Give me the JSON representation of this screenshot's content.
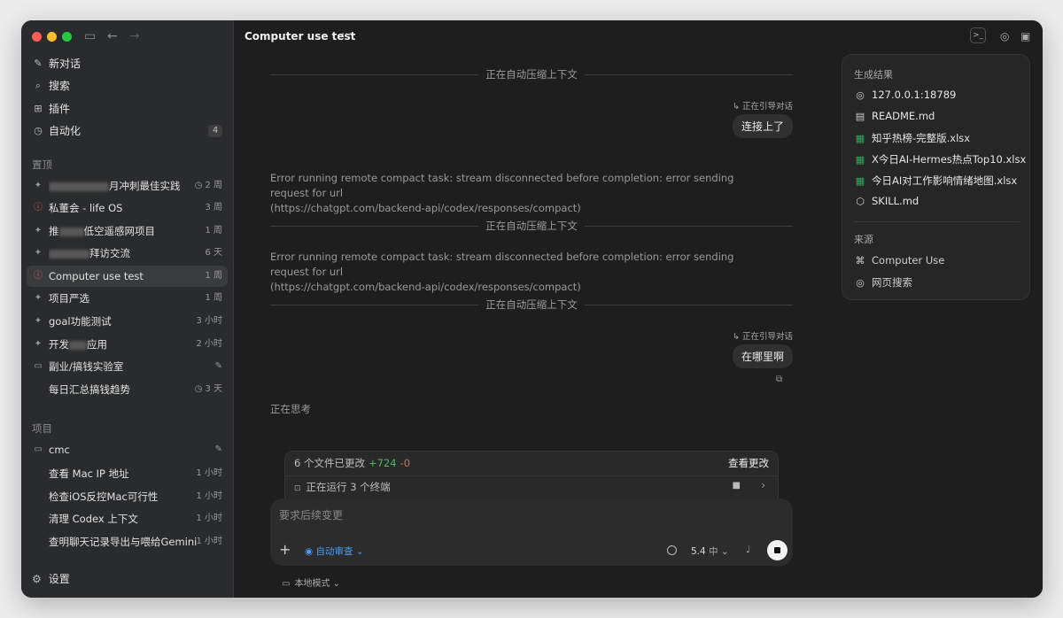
{
  "sidebar": {
    "nav": [
      {
        "icon": "edit-icon",
        "label": "新对话"
      },
      {
        "icon": "search-icon",
        "label": "搜索"
      },
      {
        "icon": "plugin-icon",
        "label": "插件"
      },
      {
        "icon": "clock-icon",
        "label": "自动化",
        "badge": "4"
      }
    ],
    "pinned_title": "置顶",
    "pinned": [
      {
        "label": "月冲刺最佳实践",
        "time": "2 周",
        "icon": "pin-icon"
      },
      {
        "label": "私董会 - life OS",
        "time": "3 周",
        "icon": "alert-icon"
      },
      {
        "label": "推",
        "label2": "低空遥感网项目",
        "time": "1 周",
        "icon": "pin-icon"
      },
      {
        "label": "拜访交流",
        "time": "6 天",
        "icon": "pin-icon"
      },
      {
        "label": "Computer use test",
        "time": "1 周",
        "icon": "alert-icon"
      },
      {
        "label": "项目严选",
        "time": "1 周",
        "icon": "pin-icon"
      },
      {
        "label": "goal功能测试",
        "time": "3 小时",
        "icon": "pin-icon"
      },
      {
        "label": "开发",
        "label2": "应用",
        "time": "2 小时",
        "icon": "pin-icon"
      },
      {
        "label": "副业/搞钱实验室",
        "icon": "folder-icon"
      },
      {
        "label": "每日汇总搞钱趋势",
        "time": "3 天"
      }
    ],
    "projects_title": "项目",
    "projects": [
      {
        "label": "cmc",
        "icon": "folder-icon"
      },
      {
        "label": "查看 Mac IP 地址",
        "time": "1 小时"
      },
      {
        "label": "检查iOS反控Mac可行性",
        "time": "1 小时"
      },
      {
        "label": "清理 Codex 上下文",
        "time": "1 小时"
      },
      {
        "label": "查明聊天记录导出与喂给Gemini",
        "time": "1 小时"
      }
    ],
    "settings_label": "设置"
  },
  "header": {
    "title": "Computer use test",
    "more": "···"
  },
  "chat": {
    "compress_label": "正在自动压缩上下文",
    "redirect_label": "正在引导对话",
    "user_msg_1": "连接上了",
    "error_line1": "Error running remote compact task: stream disconnected before completion: error sending request for url",
    "error_line2": "(https://chatgpt.com/backend-api/codex/responses/compact)",
    "user_msg_2": "在哪里啊",
    "thinking": "正在思考"
  },
  "results": {
    "title": "生成结果",
    "items": [
      {
        "icon": "globe-icon",
        "label": "127.0.0.1:18789"
      },
      {
        "icon": "document-icon",
        "label": "README.md"
      },
      {
        "icon": "excel-icon",
        "label": "知乎热榜-完整版.xlsx"
      },
      {
        "icon": "excel-icon",
        "label": "X今日AI-Hermes热点Top10.xlsx"
      },
      {
        "icon": "excel-icon",
        "label": "今日AI对工作影响情绪地图.xlsx"
      },
      {
        "icon": "cube-icon",
        "label": "SKILL.md"
      }
    ],
    "source_title": "来源",
    "sources": [
      {
        "icon": "command-icon",
        "label": "Computer Use"
      },
      {
        "icon": "globe-icon",
        "label": "网页搜索"
      }
    ]
  },
  "changes": {
    "files_text": "6 个文件已更改",
    "added": "+724",
    "removed": "-0",
    "view_label": "查看更改",
    "running_text": "正在运行 3 个终端"
  },
  "composer": {
    "placeholder": "要求后续变更",
    "auto_review": "自动审查",
    "model": "5.4",
    "effort": "中"
  },
  "footer": {
    "local_mode": "本地模式"
  }
}
